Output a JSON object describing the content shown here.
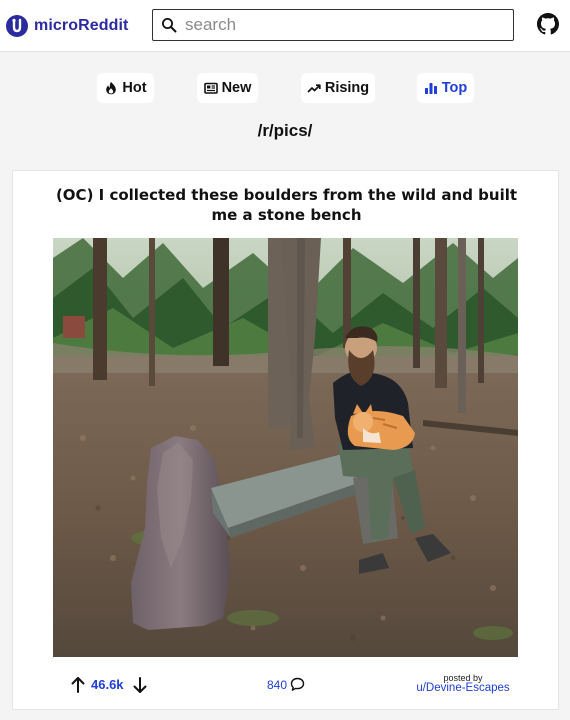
{
  "header": {
    "brand_prefix": "micro",
    "brand_suffix": "Reddit",
    "search_placeholder": "search",
    "search_value": ""
  },
  "sort_tabs": [
    {
      "label": "Hot",
      "icon": "flame-icon",
      "active": false
    },
    {
      "label": "New",
      "icon": "newspaper-icon",
      "active": false
    },
    {
      "label": "Rising",
      "icon": "trending-up-icon",
      "active": false
    },
    {
      "label": "Top",
      "icon": "bar-chart-icon",
      "active": true
    }
  ],
  "subreddit": "/r/pics/",
  "post": {
    "title": "(OC) I collected these boulders from the wild and built me a stone bench",
    "image_icon": "photo-man-with-cat-on-stone-bench",
    "score": "46.6k",
    "comments": "840",
    "posted_by_label": "posted by",
    "author": "u/Devine-Escapes"
  },
  "colors": {
    "brand": "#2b2ba0",
    "accent": "#1f3fd6",
    "page_bg": "#f4f4f4"
  }
}
